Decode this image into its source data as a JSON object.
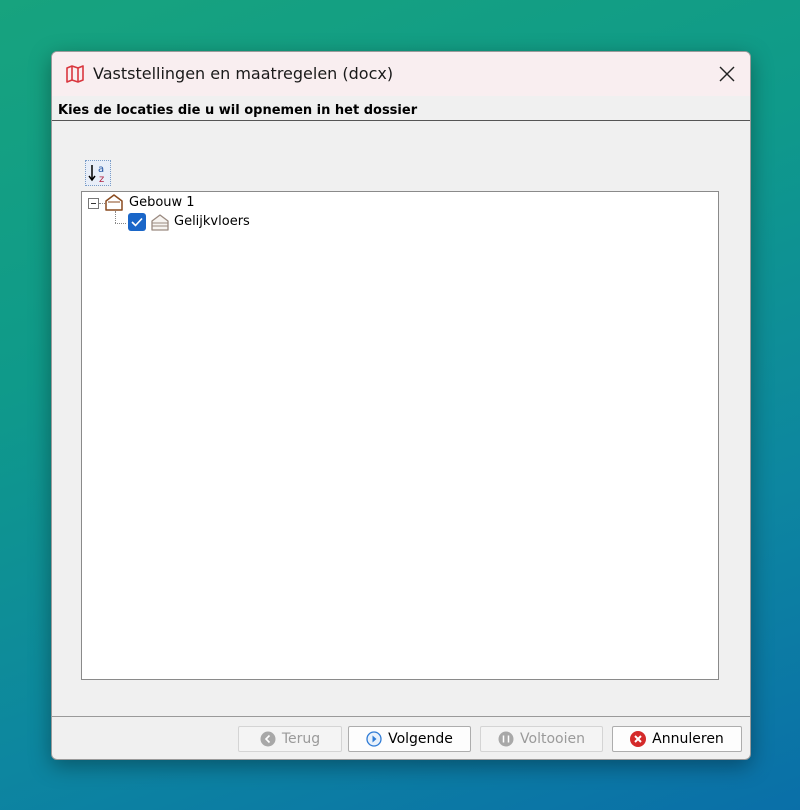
{
  "window": {
    "title": "Vaststellingen en maatregelen (docx)",
    "icon": "map-icon",
    "close_icon": "close-icon"
  },
  "header": {
    "instruction": "Kies de locaties die u wil opnemen in het dossier"
  },
  "toolbar": {
    "sort_icon": "sort-alphabetical-icon"
  },
  "tree": {
    "root": {
      "label": "Gebouw 1",
      "icon": "building-icon",
      "expanded": true,
      "children": [
        {
          "label": "Gelijkvloers",
          "icon": "floor-icon",
          "checked": true
        }
      ]
    }
  },
  "buttons": {
    "back": {
      "label": "Terug",
      "enabled": false
    },
    "next": {
      "label": "Volgende",
      "enabled": true
    },
    "finish": {
      "label": "Voltooien",
      "enabled": false
    },
    "cancel": {
      "label": "Annuleren",
      "enabled": true
    }
  },
  "colors": {
    "title_icon": "#d9363e",
    "building_icon": "#8a4a1e",
    "checkbox": "#1a66c8",
    "cancel_icon": "#d42a2a",
    "next_icon": "#2e7bd6"
  }
}
